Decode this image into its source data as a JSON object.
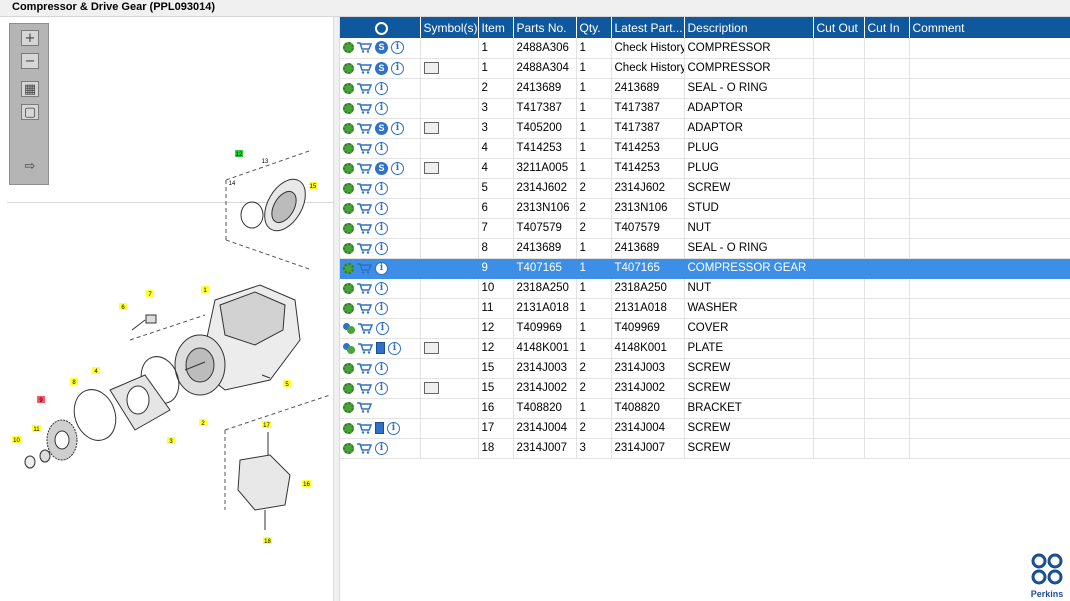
{
  "window": {
    "title": "Compressor & Drive Gear (PPL093014)"
  },
  "brand": {
    "logo_text": "Perkins",
    "accent": "#10589e",
    "selected_row": "#3d8ee6"
  },
  "toolbar": {
    "zoom_in_icon": "zoom-in-icon",
    "zoom_out_icon": "zoom-out-icon",
    "fit_icon": "fit-all-icon",
    "actual_icon": "actual-size-icon",
    "export_icon": "export-icon"
  },
  "diagram": {
    "callouts": [
      "13",
      "14",
      "15",
      "1",
      "6",
      "7",
      "2",
      "3",
      "4",
      "5",
      "8",
      "9",
      "10",
      "11",
      "17",
      "16",
      "18"
    ]
  },
  "table": {
    "headers": [
      "",
      "Symbol(s)",
      "Item",
      "Parts No.",
      "Qty.",
      "Latest Part...",
      "Description",
      "Cut Out",
      "Cut In",
      "Comment"
    ],
    "rows": [
      {
        "icons": "gear,cart,s,i",
        "symbol": false,
        "item": "1",
        "part": "2488A306",
        "qty": "1",
        "latest": "Check History",
        "desc": "COMPRESSOR"
      },
      {
        "icons": "gear,cart,s,i",
        "symbol": true,
        "item": "1",
        "part": "2488A304",
        "qty": "1",
        "latest": "Check History",
        "desc": "COMPRESSOR"
      },
      {
        "icons": "gear,cart,i",
        "symbol": false,
        "item": "2",
        "part": "2413689",
        "qty": "1",
        "latest": "2413689",
        "desc": "SEAL - O RING"
      },
      {
        "icons": "gear,cart,i",
        "symbol": false,
        "item": "3",
        "part": "T417387",
        "qty": "1",
        "latest": "T417387",
        "desc": "ADAPTOR"
      },
      {
        "icons": "gear,cart,s,i",
        "symbol": true,
        "item": "3",
        "part": "T405200",
        "qty": "1",
        "latest": "T417387",
        "desc": "ADAPTOR"
      },
      {
        "icons": "gear,cart,i",
        "symbol": false,
        "item": "4",
        "part": "T414253",
        "qty": "1",
        "latest": "T414253",
        "desc": "PLUG"
      },
      {
        "icons": "gear,cart,s,i",
        "symbol": true,
        "item": "4",
        "part": "3211A005",
        "qty": "1",
        "latest": "T414253",
        "desc": "PLUG"
      },
      {
        "icons": "gear,cart,i",
        "symbol": false,
        "item": "5",
        "part": "2314J602",
        "qty": "2",
        "latest": "2314J602",
        "desc": "SCREW"
      },
      {
        "icons": "gear,cart,i",
        "symbol": false,
        "item": "6",
        "part": "2313N106",
        "qty": "2",
        "latest": "2313N106",
        "desc": "STUD"
      },
      {
        "icons": "gear,cart,i",
        "symbol": false,
        "item": "7",
        "part": "T407579",
        "qty": "2",
        "latest": "T407579",
        "desc": "NUT"
      },
      {
        "icons": "gear,cart,i",
        "symbol": false,
        "item": "8",
        "part": "2413689",
        "qty": "1",
        "latest": "2413689",
        "desc": "SEAL - O RING"
      },
      {
        "icons": "gear,cart,i",
        "symbol": false,
        "item": "9",
        "part": "T407165",
        "qty": "1",
        "latest": "T407165",
        "desc": "COMPRESSOR GEAR",
        "selected": true
      },
      {
        "icons": "gear,cart,i",
        "symbol": false,
        "item": "10",
        "part": "2318A250",
        "qty": "1",
        "latest": "2318A250",
        "desc": "NUT"
      },
      {
        "icons": "gear,cart,i",
        "symbol": false,
        "item": "11",
        "part": "2131A018",
        "qty": "1",
        "latest": "2131A018",
        "desc": "WASHER"
      },
      {
        "icons": "gear2,cart,i",
        "symbol": false,
        "item": "12",
        "part": "T409969",
        "qty": "1",
        "latest": "T409969",
        "desc": "COVER"
      },
      {
        "icons": "gear2,cart,book,i",
        "symbol": true,
        "item": "12",
        "part": "4148K001",
        "qty": "1",
        "latest": "4148K001",
        "desc": "PLATE"
      },
      {
        "icons": "gear,cart,i",
        "symbol": false,
        "item": "15",
        "part": "2314J003",
        "qty": "2",
        "latest": "2314J003",
        "desc": "SCREW"
      },
      {
        "icons": "gear,cart,i",
        "symbol": true,
        "item": "15",
        "part": "2314J002",
        "qty": "2",
        "latest": "2314J002",
        "desc": "SCREW"
      },
      {
        "icons": "gear,cart",
        "symbol": false,
        "item": "16",
        "part": "T408820",
        "qty": "1",
        "latest": "T408820",
        "desc": "BRACKET"
      },
      {
        "icons": "gear,cart,book,i",
        "symbol": false,
        "item": "17",
        "part": "2314J004",
        "qty": "2",
        "latest": "2314J004",
        "desc": "SCREW"
      },
      {
        "icons": "gear,cart,i",
        "symbol": false,
        "item": "18",
        "part": "2314J007",
        "qty": "3",
        "latest": "2314J007",
        "desc": "SCREW"
      }
    ]
  }
}
